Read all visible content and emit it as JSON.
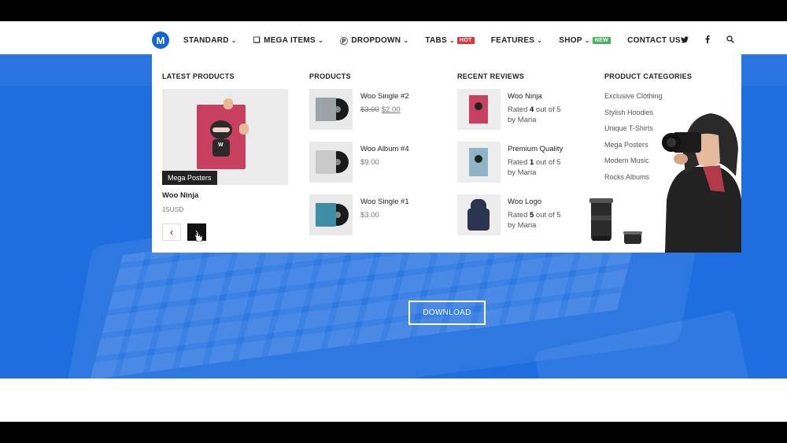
{
  "nav": {
    "logo_letter": "M",
    "items": [
      {
        "label": "STANDARD",
        "icon": "",
        "chevron": true,
        "badge": ""
      },
      {
        "label": "MEGA ITEMS",
        "icon": "cube-icon",
        "chevron": true,
        "badge": ""
      },
      {
        "label": "DROPDOWN",
        "icon": "wordpress-icon",
        "chevron": true,
        "badge": ""
      },
      {
        "label": "TABS",
        "icon": "",
        "chevron": true,
        "badge": "HOT"
      },
      {
        "label": "FEATURES",
        "icon": "",
        "chevron": true,
        "badge": ""
      },
      {
        "label": "SHOP",
        "icon": "",
        "chevron": true,
        "badge": "NEW"
      },
      {
        "label": "CONTACT US",
        "icon": "",
        "chevron": true,
        "badge": ""
      }
    ],
    "social_icons": [
      "twitter-icon",
      "facebook-icon",
      "search-icon"
    ]
  },
  "mega": {
    "latest": {
      "title": "LATEST PRODUCTS",
      "image_tag": "Mega Posters",
      "product_name": "Woo Ninja",
      "product_price": "15USD"
    },
    "products": {
      "title": "PRODUCTS",
      "items": [
        {
          "name": "Woo Single #2",
          "old_price": "$3.00",
          "price": "$2.00",
          "sleeve_color": "#9aa3a8"
        },
        {
          "name": "Woo Album #4",
          "old_price": "",
          "price": "$9.00",
          "sleeve_color": "#c9c9c9"
        },
        {
          "name": "Woo Single #1",
          "old_price": "",
          "price": "$3.00",
          "sleeve_color": "#3f8ea8"
        }
      ]
    },
    "reviews": {
      "title": "RECENT REVIEWS",
      "items": [
        {
          "name": "Woo Ninja",
          "pre": "Rated ",
          "rating": "4",
          "post": " out of 5",
          "by": "by Maria"
        },
        {
          "name": "Premium Quality",
          "pre": "Rated ",
          "rating": "1",
          "post": " out of 5",
          "by": "by Maria"
        },
        {
          "name": "Woo Logo",
          "pre": "Rated ",
          "rating": "5",
          "post": " out of 5",
          "by": "by Maria"
        }
      ]
    },
    "categories": {
      "title": "PRODUCT CATEGORIES",
      "items": [
        "Exclusive Clothing",
        "Stylish Hoodies",
        "Unique T-Shirts",
        "Mega Posters",
        "Modern Music",
        "Rocks Albums"
      ]
    }
  },
  "hero": {
    "download_label": "DOWNLOAD",
    "color": "#1f6ee0"
  }
}
